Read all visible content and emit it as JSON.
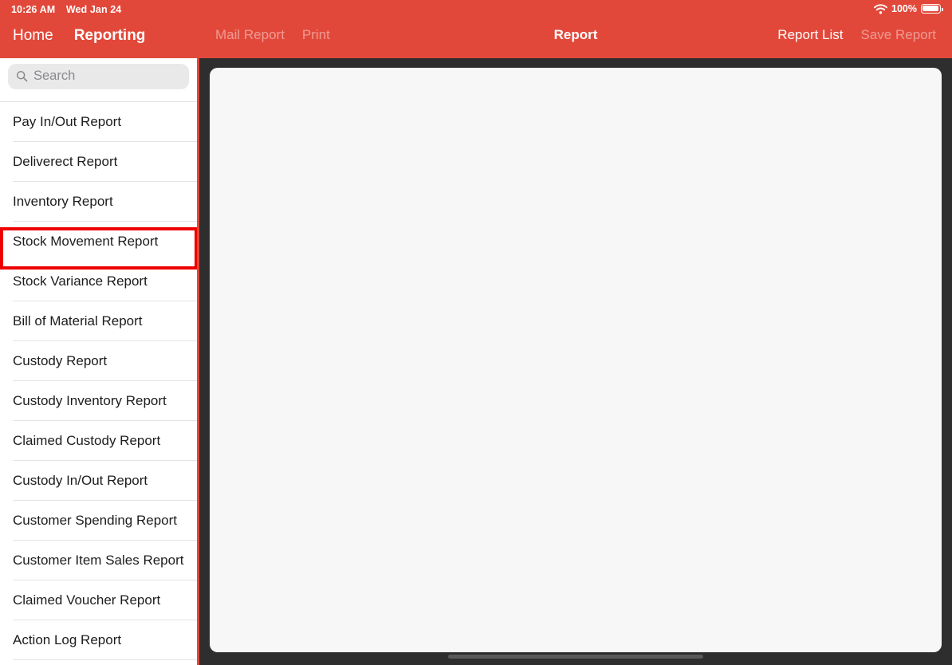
{
  "status_bar": {
    "time": "10:26 AM",
    "date": "Wed Jan 24",
    "wifi_icon": "wifi-icon",
    "battery_percent": "100%",
    "battery_icon": "battery-full-icon"
  },
  "colors": {
    "accent_red": "#e2483a",
    "highlight_red": "#ee0000",
    "device_bezel": "#2e2e2e",
    "panel_bg": "#f7f7f7",
    "separator": "#e3e3e3"
  },
  "sidebar": {
    "tabs": [
      {
        "label": "Home",
        "active": false
      },
      {
        "label": "Reporting",
        "active": true
      }
    ],
    "search": {
      "placeholder": "Search",
      "value": "",
      "icon": "search-icon"
    },
    "items": [
      {
        "label": "Pay In/Out Report",
        "selected": false
      },
      {
        "label": "Deliverect Report",
        "selected": false
      },
      {
        "label": "Inventory Report",
        "selected": false
      },
      {
        "label": "Stock Movement Report",
        "selected": true
      },
      {
        "label": "Stock Variance Report",
        "selected": false
      },
      {
        "label": "Bill of Material Report",
        "selected": false
      },
      {
        "label": "Custody Report",
        "selected": false
      },
      {
        "label": "Custody Inventory Report",
        "selected": false
      },
      {
        "label": "Claimed Custody Report",
        "selected": false
      },
      {
        "label": "Custody In/Out Report",
        "selected": false
      },
      {
        "label": "Customer Spending Report",
        "selected": false
      },
      {
        "label": "Customer Item Sales Report",
        "selected": false
      },
      {
        "label": "Claimed Voucher Report",
        "selected": false
      },
      {
        "label": "Action Log Report",
        "selected": false
      }
    ]
  },
  "navbar": {
    "title": "Report",
    "left_buttons": [
      {
        "label": "Mail Report",
        "enabled": false
      },
      {
        "label": "Print",
        "enabled": false
      }
    ],
    "right_buttons": [
      {
        "label": "Report List",
        "enabled": true
      },
      {
        "label": "Save Report",
        "enabled": false
      }
    ]
  },
  "main": {
    "report_panel_content": ""
  }
}
